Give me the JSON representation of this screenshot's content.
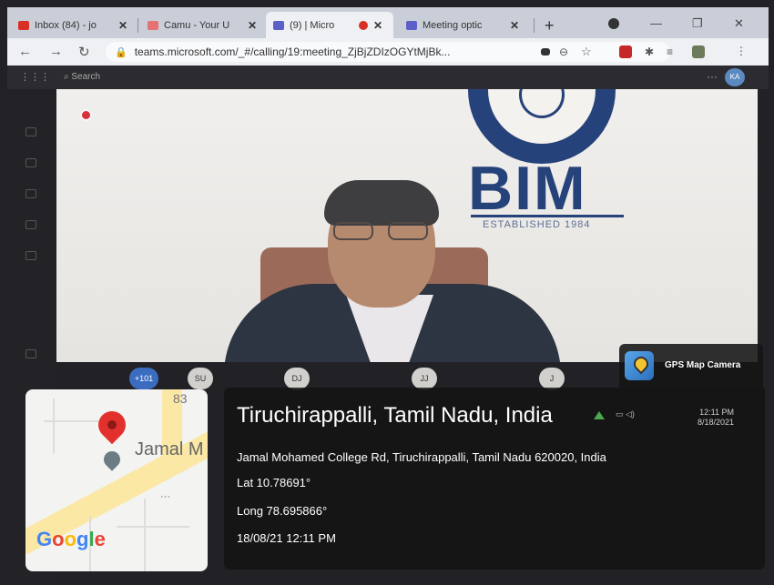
{
  "browser": {
    "tabs": [
      {
        "label": "Inbox (84) - jo",
        "color": "#d93025"
      },
      {
        "label": "Camu - Your U",
        "color": "#e57373"
      },
      {
        "label": "(9) | Micro",
        "color": "#5b5fc7"
      },
      {
        "label": "Meeting optic",
        "color": "#5b5fc7"
      }
    ],
    "url": "teams.microsoft.com/_#/calling/19:meeting_ZjBjZDIzOGYtMjBk..."
  },
  "teams": {
    "search_label": "Search",
    "avatar_initials": "KA"
  },
  "video": {
    "logo_text": "BIM",
    "logo_tagline": "ESTABLISHED 1984"
  },
  "participants": [
    "+101",
    "SU",
    "DJ",
    "JJ",
    "J"
  ],
  "tray": {
    "time": "12:11 PM",
    "date": "8/18/2021"
  },
  "gps": {
    "app_name": "GPS Map Camera",
    "place": "Tiruchirappalli, Tamil Nadu, India",
    "address": "Jamal Mohamed College Rd, Tiruchirappalli, Tamil Nadu 620020, India",
    "lat": "Lat 10.78691°",
    "long": "Long 78.695866°",
    "datetime": "18/08/21 12:11 PM",
    "map": {
      "road_number": "83",
      "poi_label": "Jamal M",
      "google_label": "Google"
    }
  },
  "colors": {
    "accent_blue": "#26427a",
    "pin_red": "#e2312d",
    "google_blue": "#4285f4",
    "google_red": "#ea4335",
    "google_yellow": "#fbbc05",
    "google_green": "#34a853"
  }
}
